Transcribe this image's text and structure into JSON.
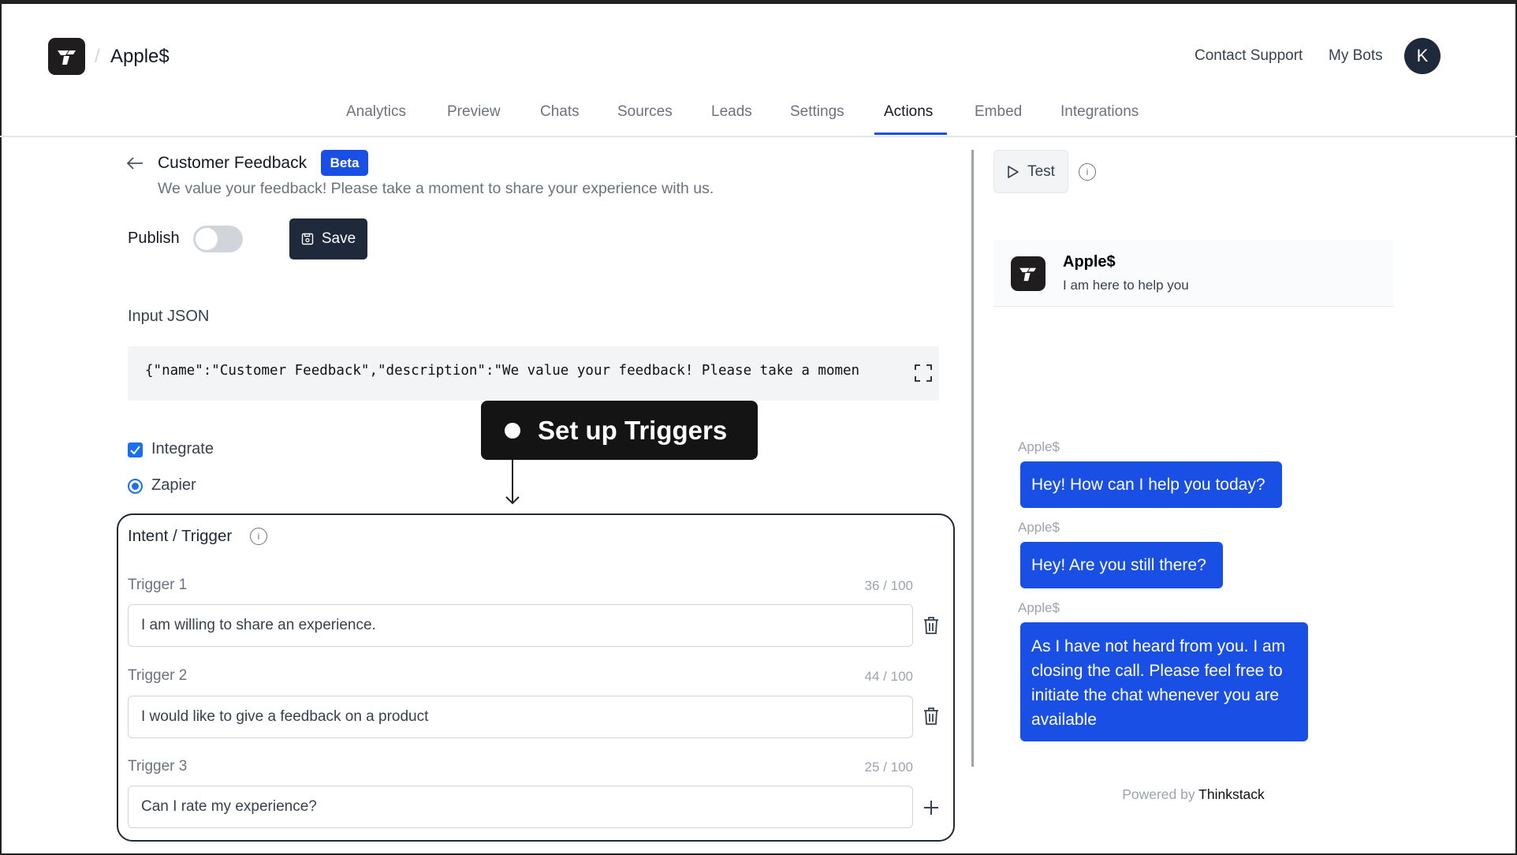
{
  "header": {
    "bot_name": "Apple$",
    "separator": "/",
    "contact_support": "Contact Support",
    "my_bots": "My Bots",
    "avatar_initial": "K"
  },
  "tabs": [
    {
      "label": "Analytics"
    },
    {
      "label": "Preview"
    },
    {
      "label": "Chats"
    },
    {
      "label": "Sources"
    },
    {
      "label": "Leads"
    },
    {
      "label": "Settings"
    },
    {
      "label": "Actions",
      "active": true
    },
    {
      "label": "Embed"
    },
    {
      "label": "Integrations"
    }
  ],
  "action": {
    "title": "Customer Feedback",
    "badge": "Beta",
    "description": "We value your feedback! Please take a moment to share your experience with us.",
    "publish_label": "Publish",
    "publish_on": false,
    "save_label": "Save",
    "input_json_label": "Input JSON",
    "input_json_value": "{\"name\":\"Customer Feedback\",\"description\":\"We value your feedback! Please take a momen",
    "integrate_label": "Integrate",
    "integrate_checked": true,
    "zapier_label": "Zapier",
    "zapier_selected": true
  },
  "tooltip": {
    "text": "Set up Triggers"
  },
  "triggers": {
    "title": "Intent / Trigger",
    "info": "i",
    "items": [
      {
        "label": "Trigger 1",
        "count": "36 / 100",
        "value": "I am willing to share an experience."
      },
      {
        "label": "Trigger 2",
        "count": "44 / 100",
        "value": "I would like to give a feedback on a product"
      },
      {
        "label": "Trigger 3",
        "count": "25 / 100",
        "value": "Can I rate my experience?"
      }
    ]
  },
  "preview": {
    "test_label": "Test",
    "info": "i",
    "bot_name": "Apple$",
    "bot_subtitle": "I am here to help you",
    "messages": [
      {
        "sender": "Apple$",
        "text": "Hey! How can I help you today?"
      },
      {
        "sender": "Apple$",
        "text": "Hey! Are you still there?"
      },
      {
        "sender": "Apple$",
        "text": "As I have not heard from you. I am closing the call. Please feel free to initiate the chat whenever you are available"
      }
    ],
    "powered_by": "Powered by",
    "brand": "Thinkstack"
  },
  "colors": {
    "accent": "#1a4fe6",
    "dark": "#1e293b"
  }
}
